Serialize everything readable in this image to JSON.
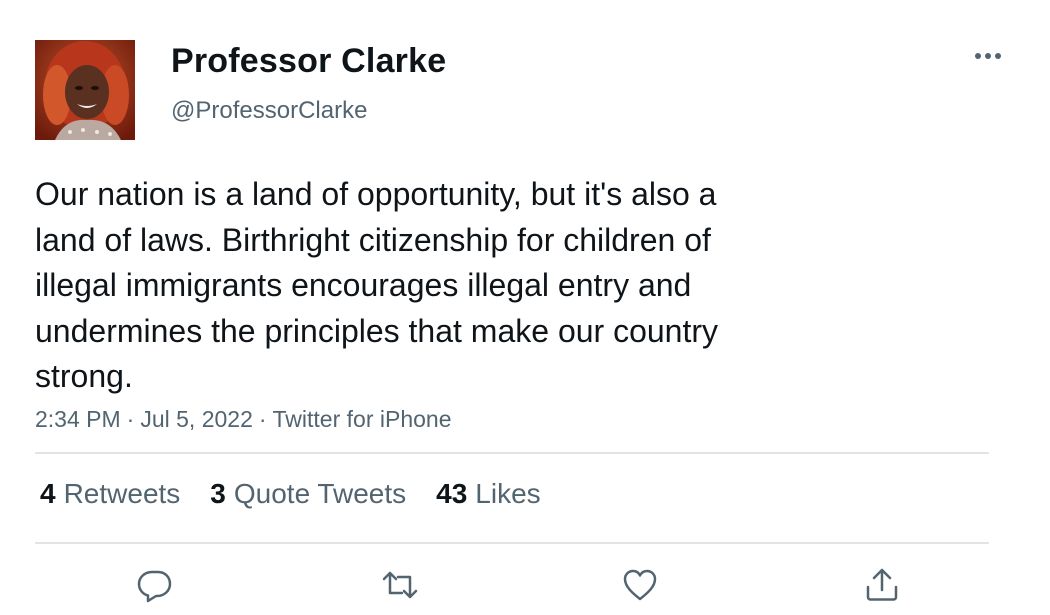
{
  "author": {
    "display_name": "Professor Clarke",
    "handle": "@ProfessorClarke",
    "avatar": "profile-photo"
  },
  "tweet": {
    "lines": [
      "Our nation is a land of opportunity, but it's also a",
      "land of laws. Birthright citizenship for children of",
      "illegal immigrants encourages illegal entry and",
      "undermines the principles that make our country",
      "strong."
    ],
    "time": "2:34 PM",
    "separator": "·",
    "date": "Jul 5, 2022",
    "source": "Twitter for iPhone"
  },
  "stats": {
    "retweets": {
      "count": "4",
      "label": "Retweets"
    },
    "quotes": {
      "count": "3",
      "label": "Quote Tweets"
    },
    "likes": {
      "count": "43",
      "label": "Likes"
    }
  },
  "actions": {
    "reply": "reply-icon",
    "retweet": "retweet-icon",
    "like": "heart-icon",
    "share": "share-icon",
    "more": "more-icon"
  },
  "colors": {
    "text": "#0f1419",
    "secondary": "#536471",
    "divider": "#e1e4e7"
  }
}
